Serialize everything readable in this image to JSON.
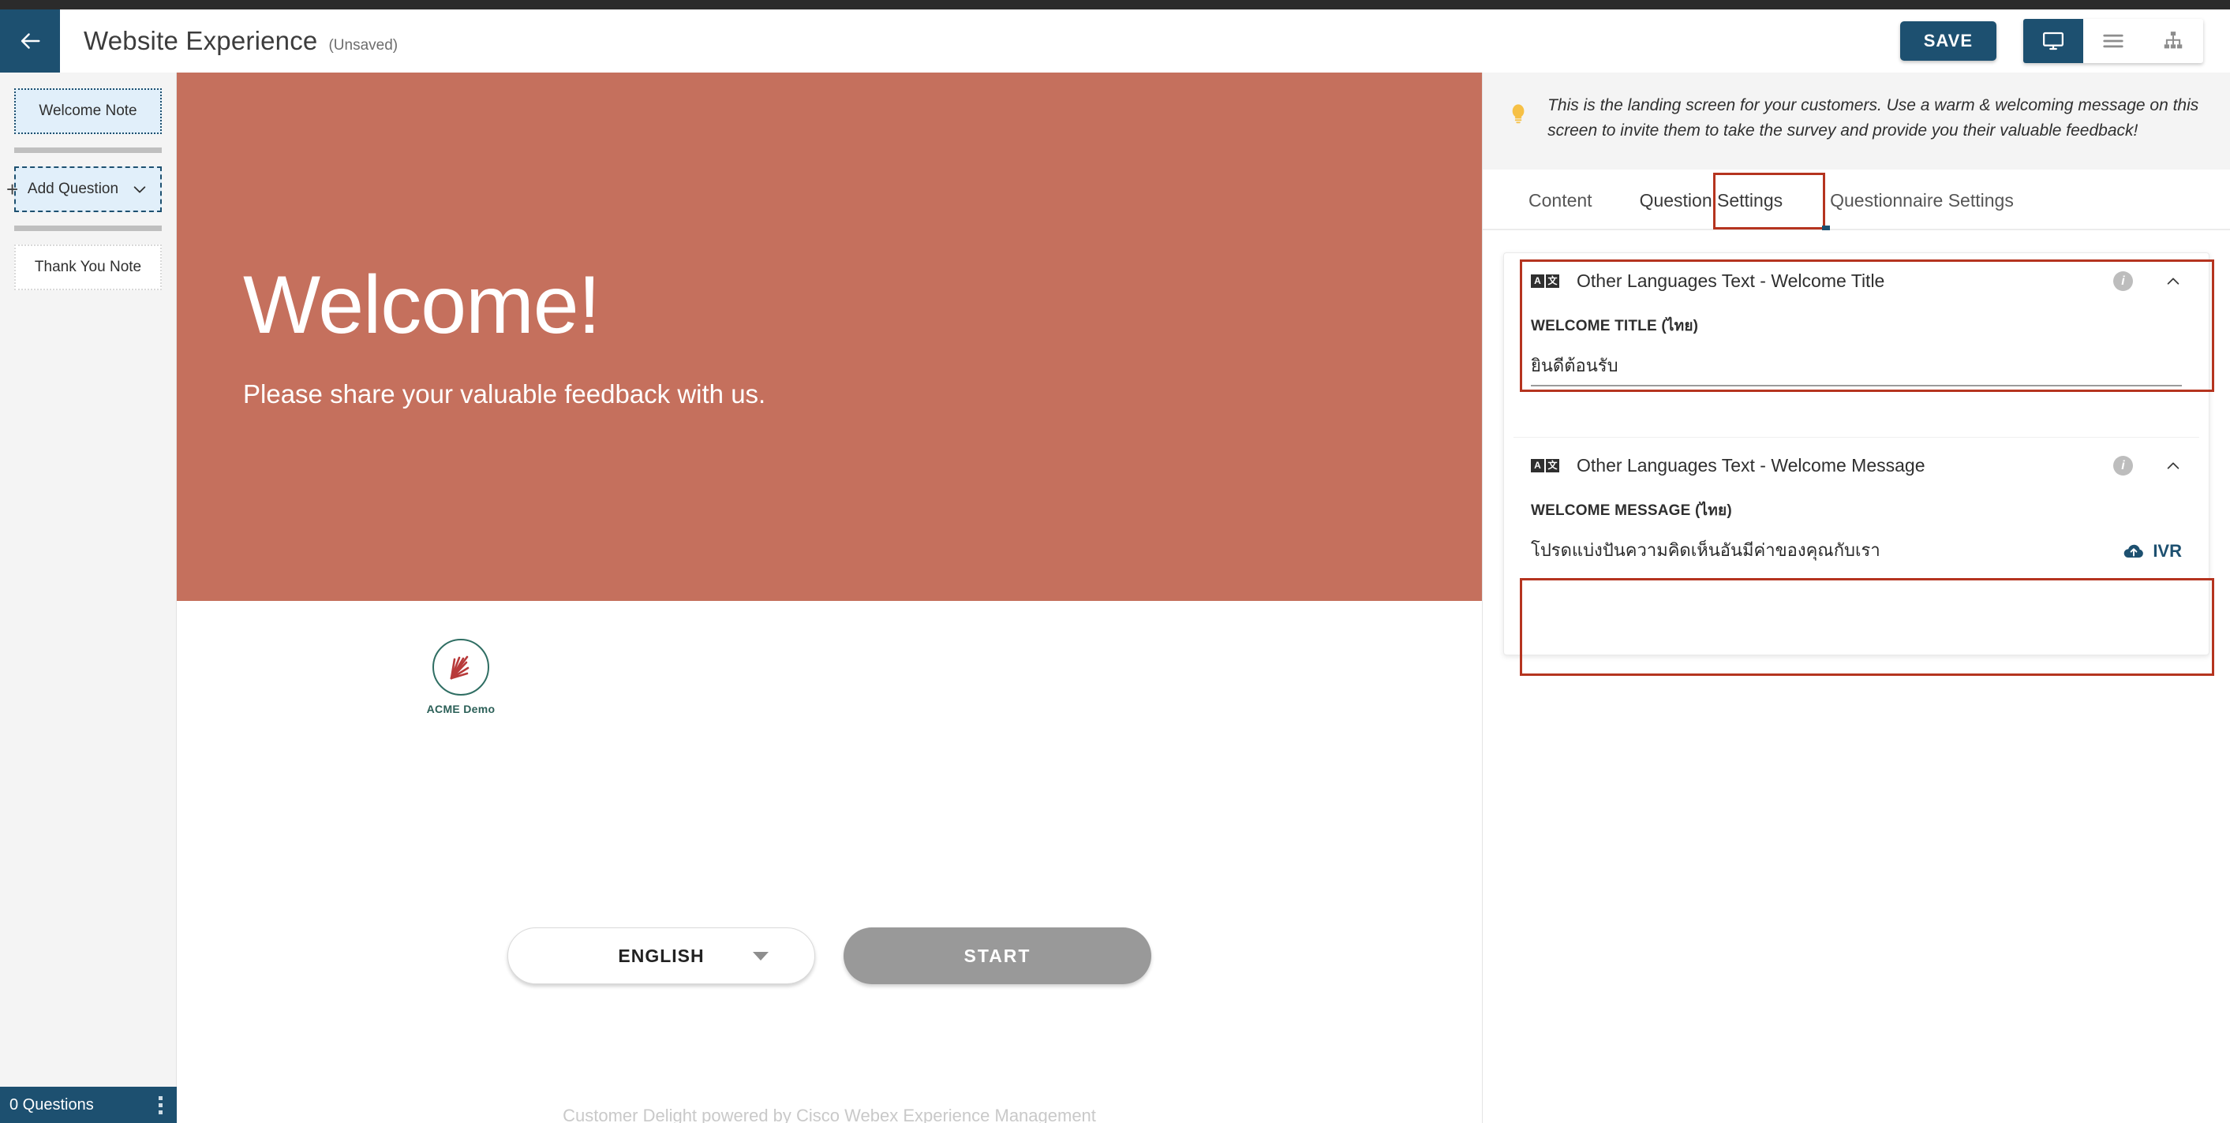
{
  "header": {
    "back_icon": "arrow-left-icon",
    "title": "Website Experience",
    "unsaved": "(Unsaved)",
    "save_label": "SAVE",
    "view_modes": [
      {
        "name": "desktop-preview",
        "icon": "monitor-icon",
        "active": true
      },
      {
        "name": "list-view",
        "icon": "hamburger-icon",
        "active": false
      },
      {
        "name": "flow-view",
        "icon": "sitemap-icon",
        "active": false
      }
    ],
    "accent_color": "#1d5070"
  },
  "sidebar": {
    "items": [
      {
        "label": "Welcome Note",
        "style": "selected"
      },
      {
        "label": "Add Question",
        "style": "add",
        "caret": "chevron-down-icon",
        "plus": "+"
      },
      {
        "label": "Thank You Note",
        "style": "plain"
      }
    ],
    "footer": {
      "count_label": "0 Questions",
      "menu_icon": "kebab-menu-icon"
    }
  },
  "preview": {
    "hero": {
      "title": "Welcome!",
      "subtitle": "Please share your valuable feedback with us.",
      "background_color": "#c5705d"
    },
    "brand": {
      "name": "ACME Demo",
      "logo_icon": "acme-fern-logo"
    },
    "language_select": {
      "value": "ENGLISH",
      "caret": "chevron-down-icon"
    },
    "start_button": {
      "label": "START",
      "color": "#999999"
    },
    "footer_note": "Customer Delight powered by Cisco Webex Experience Management"
  },
  "right_panel": {
    "tip": {
      "icon": "lightbulb-icon",
      "text": "This is the landing screen for your customers. Use a warm & welcoming message on this screen to invite them to take the survey and provide you their valuable feedback!"
    },
    "tabs": [
      {
        "label": "Content",
        "active": false
      },
      {
        "label": "Question Settings",
        "active": true,
        "highlighted": true
      },
      {
        "label": "Questionnaire Settings",
        "active": false
      }
    ],
    "cards": [
      {
        "icon": "translate-icon",
        "icon_glyphs": [
          "A",
          "文"
        ],
        "title": "Other Languages Text - Welcome Title",
        "info_icon": "info-icon",
        "collapse_icon": "chevron-up-icon",
        "field_label": "WELCOME TITLE (ไทย)",
        "field_value": "ยินดีต้อนรับ",
        "field_placeholder": "",
        "has_ivr": false,
        "highlighted": true
      },
      {
        "icon": "translate-icon",
        "icon_glyphs": [
          "A",
          "文"
        ],
        "title": "Other Languages Text - Welcome Message",
        "info_icon": "info-icon",
        "collapse_icon": "chevron-up-icon",
        "field_label": "WELCOME MESSAGE (ไทย)",
        "field_value": "โปรดแบ่งปันความคิดเห็นอันมีค่าของคุณกับเรา",
        "field_placeholder": "",
        "has_ivr": true,
        "ivr_label": "IVR",
        "ivr_icon": "cloud-upload-icon",
        "highlighted": true
      }
    ],
    "annotation_color": "#b5341f"
  }
}
